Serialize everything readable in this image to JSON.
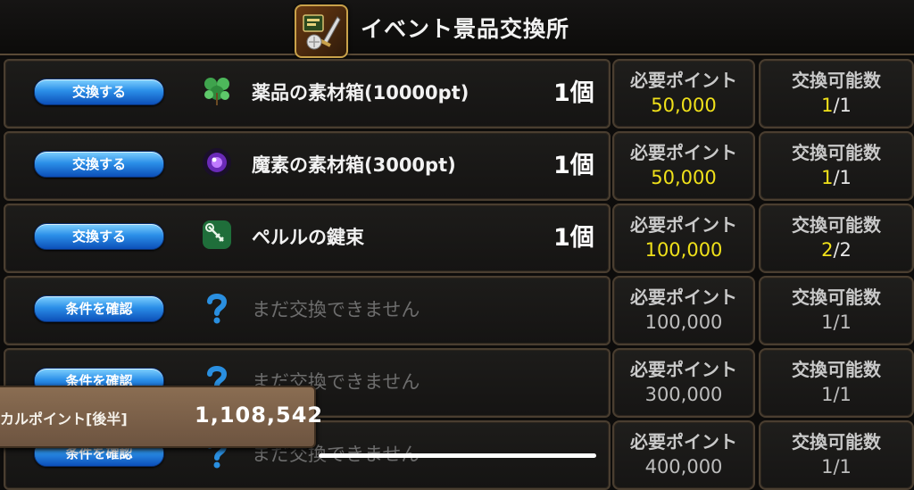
{
  "header": {
    "title": "イベント景品交換所",
    "emblem_icon": "event-emblem-icon"
  },
  "labels": {
    "need": "必要ポイント",
    "count": "交換可能数"
  },
  "rows": [
    {
      "button": "交換する",
      "icon": "herb-icon",
      "name": "薬品の素材箱(10000pt)",
      "qty": "1個",
      "need": "50,000",
      "have": "1",
      "total": "/1",
      "locked": false
    },
    {
      "button": "交換する",
      "icon": "magic-orb-icon",
      "name": "魔素の素材箱(3000pt)",
      "qty": "1個",
      "need": "50,000",
      "have": "1",
      "total": "/1",
      "locked": false
    },
    {
      "button": "交換する",
      "icon": "key-bundle-icon",
      "name": "ペルルの鍵束",
      "qty": "1個",
      "need": "100,000",
      "have": "2",
      "total": "/2",
      "locked": false
    },
    {
      "button": "条件を確認",
      "icon": "question-icon",
      "name": "まだ交換できません",
      "qty": "",
      "need": "100,000",
      "have": "1",
      "total": "/1",
      "locked": true
    },
    {
      "button": "条件を確認",
      "icon": "question-icon",
      "name": "まだ交換できません",
      "qty": "",
      "need": "300,000",
      "have": "1",
      "total": "/1",
      "locked": true
    },
    {
      "button": "条件を確認",
      "icon": "question-icon",
      "name": "まだ交換できません",
      "qty": "",
      "need": "400,000",
      "have": "1",
      "total": "/1",
      "locked": true
    }
  ],
  "points": {
    "label": "カルポイント[後半]",
    "value": "1,108,542"
  },
  "colors": {
    "accent": "#f0e11a",
    "button": "#2b8fe8",
    "frame": "#4a3e30"
  }
}
